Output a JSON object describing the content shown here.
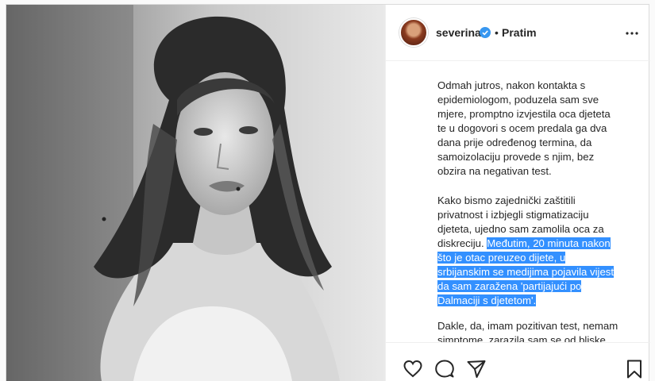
{
  "post": {
    "username": "severina",
    "separator": "•",
    "follow_label": "Pratim",
    "icons": {
      "verified": "verified-badge-icon",
      "more": "more-options-icon",
      "like": "heart-icon",
      "comment": "comment-icon",
      "share": "share-icon",
      "save": "bookmark-icon"
    },
    "accent_color": "#3897f0",
    "selection_color": "#3390ff"
  },
  "caption": {
    "p1": "Odmah jutros, nakon kontakta s\nepidemiologom, poduzela sam sve\nmjere, promptno izvjestila oca djeteta\nte u dogovori s ocem predala ga dva\ndana prije određenog termina, da\nsamoizolaciju provede s njim, bez\nobzira na negativan test.",
    "p2_plain": "Kako bismo zajednički zaštitili\nprivatnost i izbjegli stigmatizaciju\ndjeteta, ujedno sam zamolila oca za\ndiskreciju. ",
    "p2_selected": "Međutim, 20 minuta nakon\nšto je otac preuzeo dijete, u\nsrbijanskim se medijima pojavila vijest\nda sam zaražena 'partijajući po\nDalmaciji s djetetom'.",
    "p3": "Dakle, da, imam pozitivan test, nemam\nsimptome, zarazila sam se od bliske"
  }
}
